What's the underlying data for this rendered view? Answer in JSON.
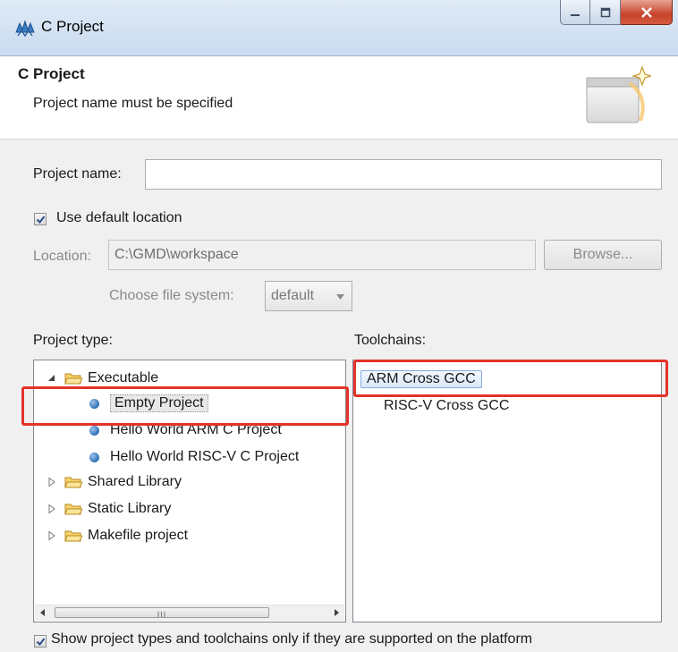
{
  "window": {
    "title": "C Project",
    "buttons": {
      "minimize": "minimize",
      "maximize": "maximize",
      "close": "close"
    }
  },
  "header": {
    "title": "C Project",
    "message": "Project name must be specified"
  },
  "form": {
    "project_name_label": "Project name:",
    "project_name_value": "",
    "use_default_label": "Use default location",
    "use_default_checked": true,
    "location_label": "Location:",
    "location_value": "C:\\GMD\\workspace",
    "browse_label": "Browse...",
    "file_system_label": "Choose file system:",
    "file_system_value": "default"
  },
  "project_type": {
    "label": "Project type:",
    "items": [
      {
        "label": "Executable",
        "kind": "folder",
        "expanded": true
      },
      {
        "label": "Empty Project",
        "kind": "leaf",
        "selected": true
      },
      {
        "label": "Hello World ARM C Project",
        "kind": "leaf"
      },
      {
        "label": "Hello World RISC-V C Project",
        "kind": "leaf"
      },
      {
        "label": "Shared Library",
        "kind": "folder",
        "expanded": false
      },
      {
        "label": "Static Library",
        "kind": "folder",
        "expanded": false
      },
      {
        "label": "Makefile project",
        "kind": "folder",
        "expanded": false
      }
    ],
    "scroll_grip": "III"
  },
  "toolchains": {
    "label": "Toolchains:",
    "items": [
      {
        "label": "ARM Cross GCC",
        "selected": true
      },
      {
        "label": "RISC-V Cross GCC"
      }
    ]
  },
  "footer": {
    "show_supported_label": "Show project types and toolchains only if they are supported on the platform",
    "show_supported_checked": true
  },
  "colors": {
    "highlight_box": "#e4322b",
    "selection_border": "#84acdd",
    "bullet": "#2c6fb5"
  }
}
